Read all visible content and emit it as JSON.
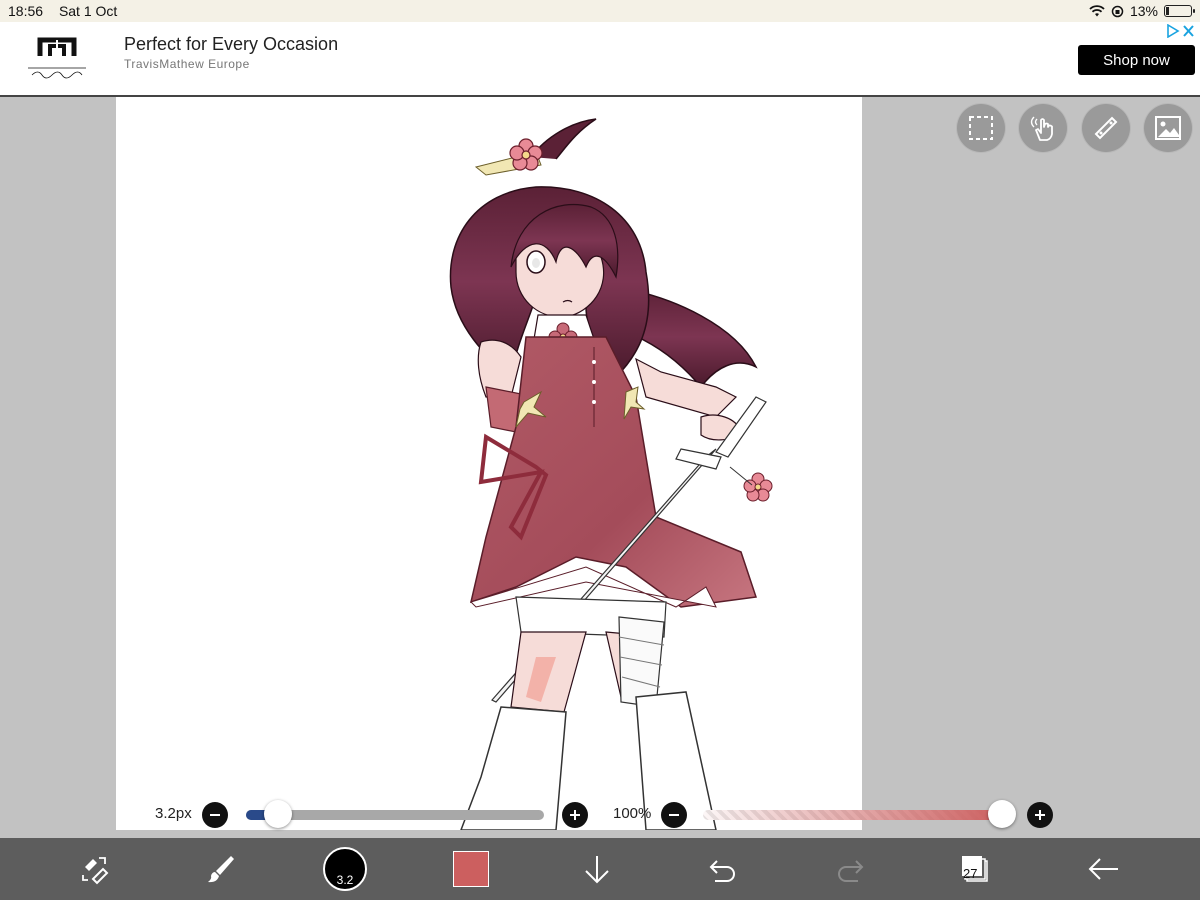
{
  "status_bar": {
    "time": "18:56",
    "date": "Sat 1 Oct",
    "battery": "13%",
    "battery_level": 0.13
  },
  "ad": {
    "brand_logo_text": "travisMathew",
    "headline": "Perfect for Every Occasion",
    "advertiser": "TravisMathew Europe",
    "cta": "Shop now",
    "adchoices_icon": "adchoices-icon",
    "close_icon": "close-icon"
  },
  "floating_tools": [
    {
      "name": "selection-tool",
      "icon": "dashed-square-icon"
    },
    {
      "name": "hand-tool",
      "icon": "hand-pointer-icon"
    },
    {
      "name": "ruler-tool",
      "icon": "ruler-icon"
    },
    {
      "name": "image-tool",
      "icon": "image-icon"
    }
  ],
  "brush_size": {
    "label": "3.2px",
    "value": 3.2,
    "level": 0.06
  },
  "opacity": {
    "label": "100%",
    "value": 100,
    "level": 1.0
  },
  "toolbar": {
    "transform_icon": "transform-eraser-icon",
    "brush_icon": "brush-icon",
    "brush_size_display": "3.2",
    "current_color": "#cc5f5f",
    "download_icon": "arrow-down-icon",
    "undo_icon": "undo-icon",
    "redo_icon": "redo-icon",
    "layers_count": "27",
    "back_icon": "arrow-left-icon"
  },
  "colors": {
    "accent": "#cc5f5f",
    "toolbar_bg": "#5d5d5d",
    "workspace_bg": "#c2c2c2",
    "slider_fill": "#2a4a8a"
  }
}
